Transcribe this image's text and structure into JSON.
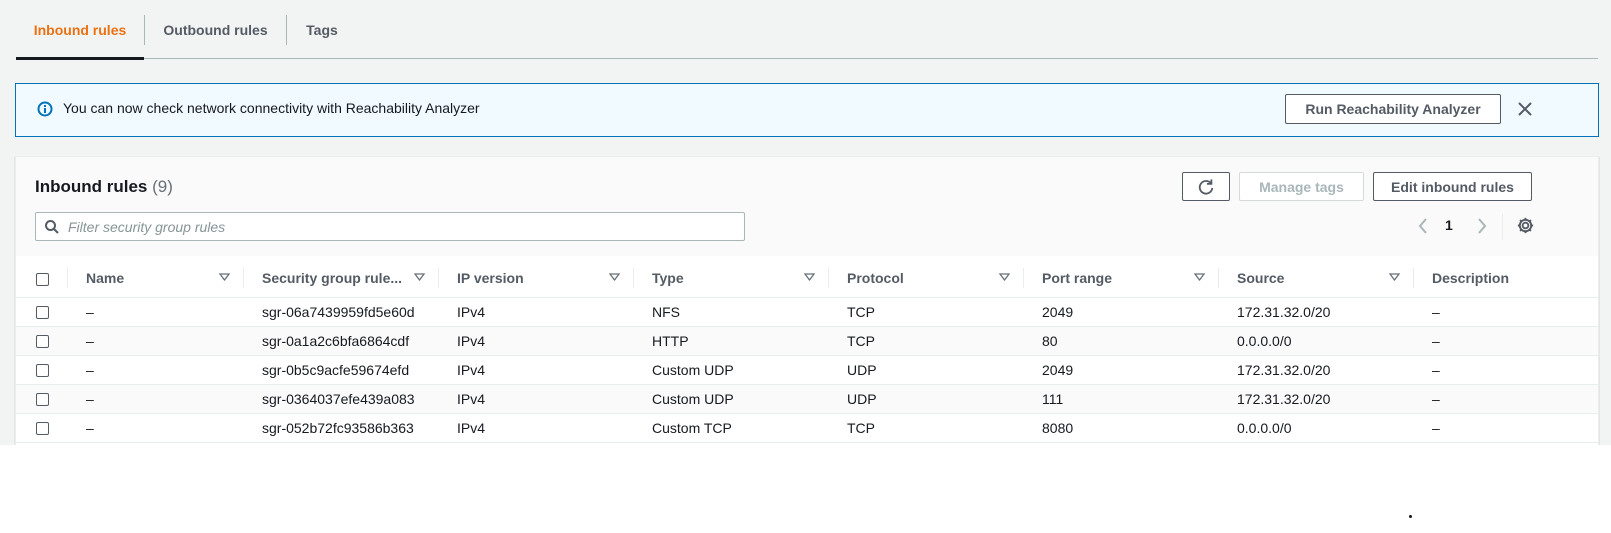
{
  "tabs": [
    {
      "label": "Inbound rules",
      "active": true
    },
    {
      "label": "Outbound rules",
      "active": false
    },
    {
      "label": "Tags",
      "active": false
    }
  ],
  "flash": {
    "message": "You can now check network connectivity with Reachability Analyzer",
    "button_label": "Run Reachability Analyzer",
    "icon": "info-icon",
    "close_icon": "close-icon"
  },
  "panel": {
    "title": "Inbound rules",
    "count": "(9)",
    "manage_tags_label": "Manage tags",
    "edit_label": "Edit inbound rules",
    "search_placeholder": "Filter security group rules",
    "page": "1"
  },
  "table": {
    "columns": [
      "Name",
      "Security group rule...",
      "IP version",
      "Type",
      "Protocol",
      "Port range",
      "Source",
      "Description"
    ],
    "rows": [
      {
        "name": "–",
        "rule_id": "sgr-06a7439959fd5e60d",
        "ip_version": "IPv4",
        "type": "NFS",
        "protocol": "TCP",
        "port_range": "2049",
        "source": "172.31.32.0/20",
        "description": "–"
      },
      {
        "name": "–",
        "rule_id": "sgr-0a1a2c6bfa6864cdf",
        "ip_version": "IPv4",
        "type": "HTTP",
        "protocol": "TCP",
        "port_range": "80",
        "source": "0.0.0.0/0",
        "description": "–"
      },
      {
        "name": "–",
        "rule_id": "sgr-0b5c9acfe59674efd",
        "ip_version": "IPv4",
        "type": "Custom UDP",
        "protocol": "UDP",
        "port_range": "2049",
        "source": "172.31.32.0/20",
        "description": "–"
      },
      {
        "name": "–",
        "rule_id": "sgr-0364037efe439a083",
        "ip_version": "IPv4",
        "type": "Custom UDP",
        "protocol": "UDP",
        "port_range": "111",
        "source": "172.31.32.0/20",
        "description": "–"
      },
      {
        "name": "–",
        "rule_id": "sgr-052b72fc93586b363",
        "ip_version": "IPv4",
        "type": "Custom TCP",
        "protocol": "TCP",
        "port_range": "8080",
        "source": "0.0.0.0/0",
        "description": "–"
      }
    ]
  },
  "colors": {
    "accent": "#ec7211",
    "info_blue": "#0073bb",
    "flash_bg": "#f1faff",
    "page_bg": "#f2f3f3"
  }
}
